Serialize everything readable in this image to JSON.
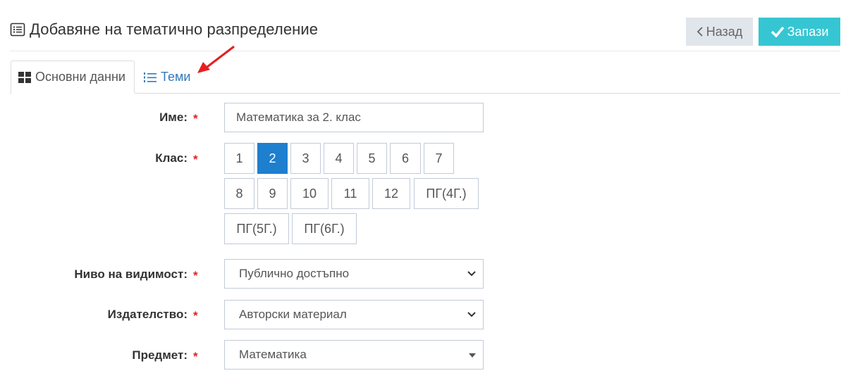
{
  "header": {
    "title": "Добавяне на тематично разпределение",
    "title_icon": "list-alt-icon",
    "back_label": "Назад",
    "save_label": "Запази"
  },
  "tabs": [
    {
      "label": "Основни данни",
      "icon": "grid-icon",
      "active": true
    },
    {
      "label": "Теми",
      "icon": "ordered-list-icon",
      "active": false
    }
  ],
  "form": {
    "name": {
      "label": "Име:",
      "value": "Математика за 2. клас"
    },
    "grade": {
      "label": "Клас:",
      "options": [
        "1",
        "2",
        "3",
        "4",
        "5",
        "6",
        "7",
        "8",
        "9",
        "10",
        "11",
        "12",
        "ПГ(4Г.)",
        "ПГ(5Г.)",
        "ПГ(6Г.)"
      ],
      "selected": "2"
    },
    "visibility": {
      "label": "Ниво на видимост:",
      "value": "Публично достъпно"
    },
    "publisher": {
      "label": "Издателство:",
      "value": "Авторски материал"
    },
    "subject": {
      "label": "Предмет:",
      "value": "Математика"
    },
    "required_mark": "*"
  },
  "colors": {
    "accent_blue": "#1e7fcf",
    "save_teal": "#36c6d3",
    "back_gray": "#e1e5ec",
    "required_red": "#e02222",
    "link_blue": "#337ab7",
    "annotation_arrow": "#e51f1f"
  }
}
